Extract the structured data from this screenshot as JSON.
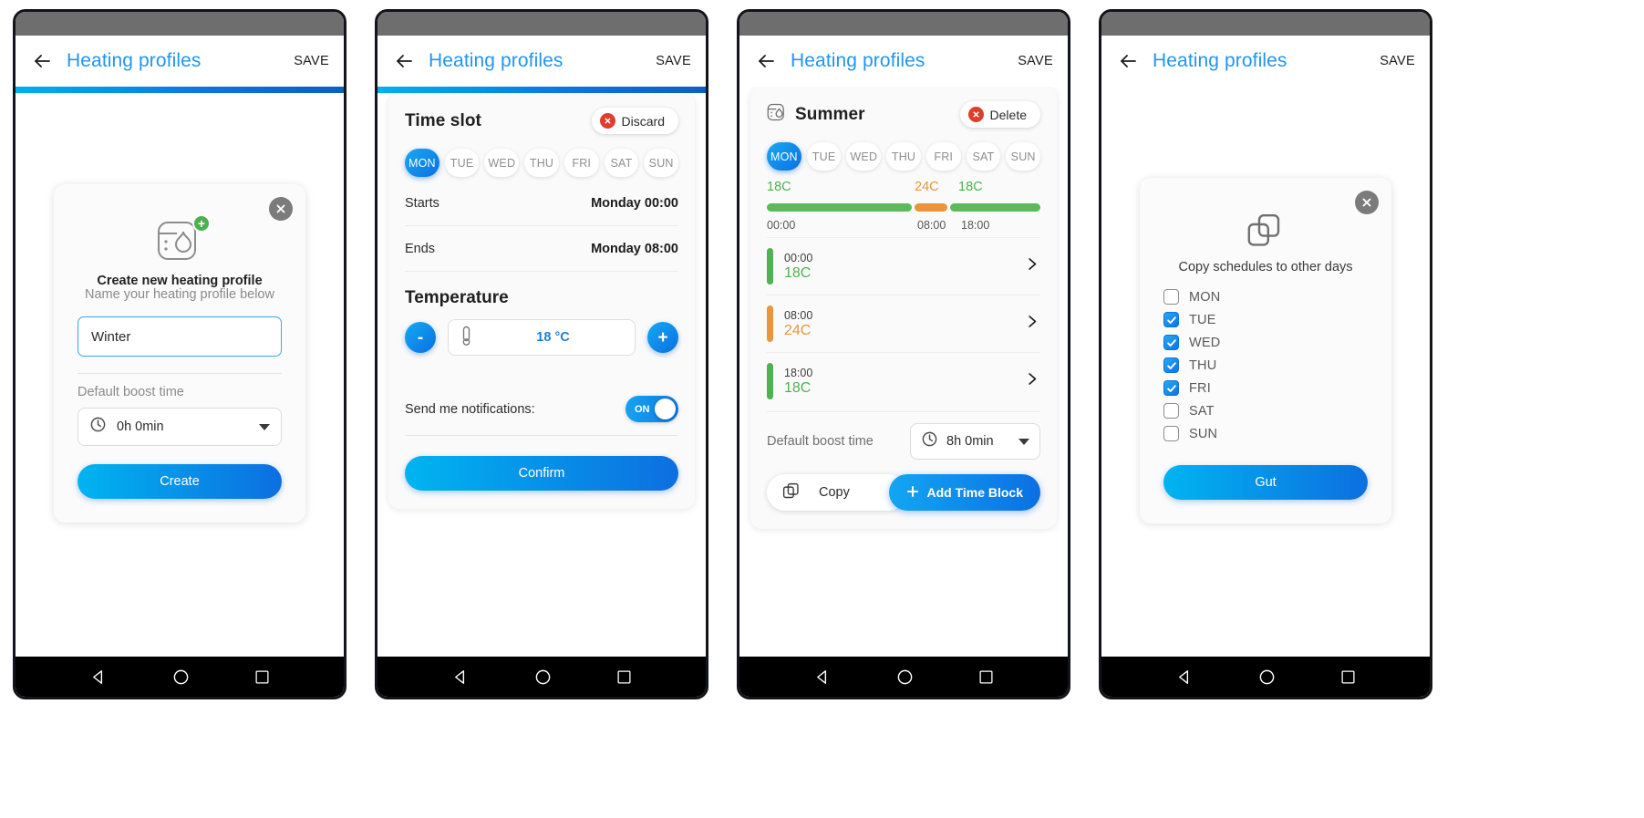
{
  "appbar": {
    "title": "Heating profiles",
    "save_label": "SAVE",
    "back_icon": "back-arrow-icon"
  },
  "panel1": {
    "close_icon": "close-icon",
    "profile_icon": "heating-profile-icon",
    "plus_badge": "+",
    "title": "Create new heating profile",
    "subtitle": "Name your heating profile below",
    "name_value": "Winter",
    "name_placeholder": "Name your heating profile below",
    "boost_label": "Default boost time",
    "boost_value": "0h 0min",
    "clock_icon": "clock-icon",
    "create_label": "Create"
  },
  "panel2": {
    "sheet_title": "Time slot",
    "discard_label": "Discard",
    "discard_icon": "discard-circle-icon",
    "days": [
      {
        "label": "MON",
        "active": true
      },
      {
        "label": "TUE",
        "active": false
      },
      {
        "label": "WED",
        "active": false
      },
      {
        "label": "THU",
        "active": false
      },
      {
        "label": "FRI",
        "active": false
      },
      {
        "label": "SAT",
        "active": false
      },
      {
        "label": "SUN",
        "active": false
      }
    ],
    "starts_label": "Starts",
    "starts_value": "Monday 00:00",
    "ends_label": "Ends",
    "ends_value": "Monday 08:00",
    "temperature_title": "Temperature",
    "minus_label": "-",
    "plus_label": "+",
    "temp_value": "18 °C",
    "thermometer_icon": "thermometer-icon",
    "notif_label": "Send me notifications:",
    "toggle_state": "ON",
    "confirm_label": "Confirm"
  },
  "panel3": {
    "profile_icon": "heating-profile-icon",
    "profile_name": "Summer",
    "delete_label": "Delete",
    "delete_icon": "delete-circle-icon",
    "days": [
      {
        "label": "MON",
        "active": true
      },
      {
        "label": "TUE",
        "active": false
      },
      {
        "label": "WED",
        "active": false
      },
      {
        "label": "THU",
        "active": false
      },
      {
        "label": "FRI",
        "active": false
      },
      {
        "label": "SAT",
        "active": false
      },
      {
        "label": "SUN",
        "active": false
      }
    ],
    "timeline": {
      "segments": [
        {
          "temp": "18C",
          "time": "00:00",
          "color": "#5cba5c",
          "width_pct": 53
        },
        {
          "temp": "24C",
          "time": "08:00",
          "color": "#e8953b",
          "width_pct": 12
        },
        {
          "temp": "18C",
          "time": "18:00",
          "color": "#5cba5c",
          "width_pct": 35
        }
      ]
    },
    "blocks": [
      {
        "time": "00:00",
        "temp": "18C",
        "color": "#4fb14f"
      },
      {
        "time": "08:00",
        "temp": "24C",
        "color": "#e8953b"
      },
      {
        "time": "18:00",
        "temp": "18C",
        "color": "#4fb14f"
      }
    ],
    "chevron_icon": "chevron-right-icon",
    "boost_label": "Default boost time",
    "boost_value": "8h 0min",
    "clock_icon": "clock-icon",
    "copy_label": "Copy",
    "copy_icon": "copy-icon",
    "add_label": "Add Time Block",
    "add_icon": "plus-icon"
  },
  "panel4": {
    "close_icon": "close-icon",
    "copy_icon": "copy-schedules-icon",
    "title": "Copy schedules to other days",
    "days": [
      {
        "label": "MON",
        "checked": false
      },
      {
        "label": "TUE",
        "checked": true
      },
      {
        "label": "WED",
        "checked": true
      },
      {
        "label": "THU",
        "checked": true
      },
      {
        "label": "FRI",
        "checked": true
      },
      {
        "label": "SAT",
        "checked": false
      },
      {
        "label": "SUN",
        "checked": false
      }
    ],
    "confirm_label": "Gut"
  },
  "navbar": {
    "back_icon": "nav-back-triangle-icon",
    "home_icon": "nav-home-circle-icon",
    "recents_icon": "nav-recents-square-icon"
  },
  "colors": {
    "accent_blue": "#2196f3",
    "green": "#4fb14f",
    "orange": "#e8953b",
    "red": "#e03e2d",
    "badge_green": "#4caf50"
  }
}
